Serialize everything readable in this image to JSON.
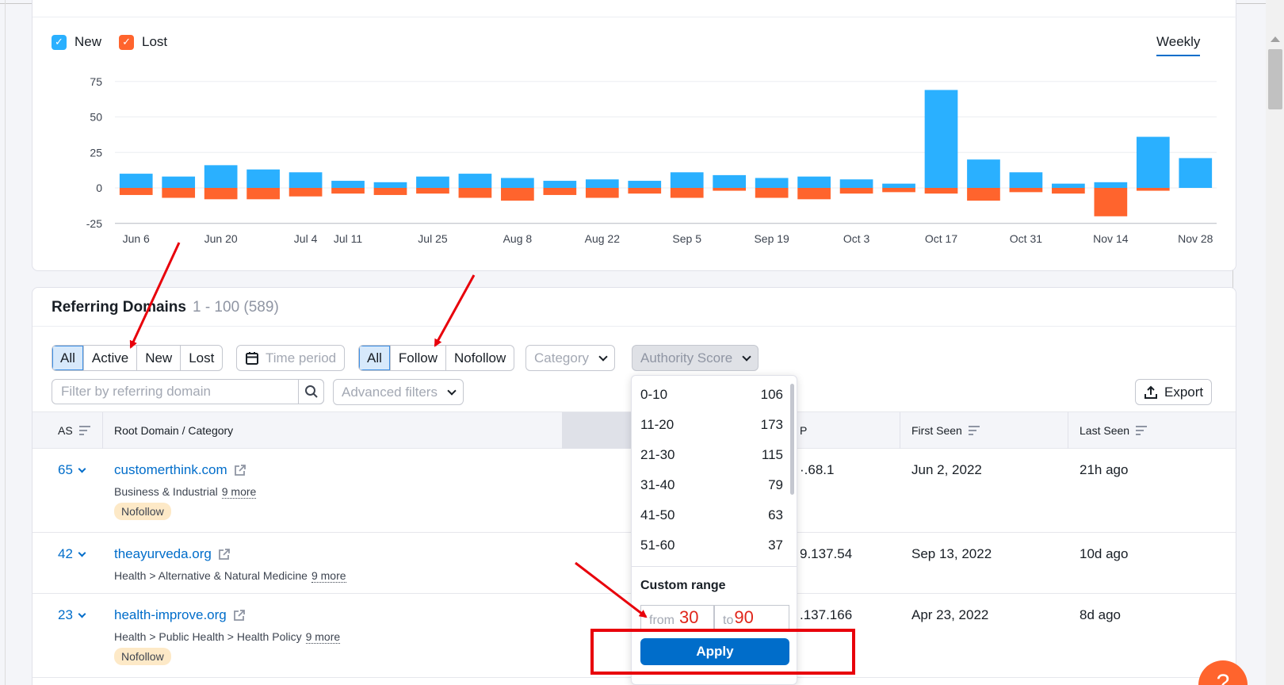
{
  "legend": {
    "new_label": "New",
    "lost_label": "Lost",
    "new_color": "#2ab0ff",
    "lost_color": "#ff642d"
  },
  "period_toggle": "Weekly",
  "chart_data": {
    "type": "bar",
    "title": "",
    "xlabel": "",
    "ylabel": "",
    "yticks": [
      75,
      50,
      25,
      0,
      -25
    ],
    "ylim": [
      -25,
      75
    ],
    "grid": true,
    "legend_position": "top-left",
    "x_tick_labels": [
      "Jun 6",
      "Jun 20",
      "Jul 4",
      "Jul 11",
      "Jul 25",
      "Aug 8",
      "Aug 22",
      "Sep 5",
      "Sep 19",
      "Oct 3",
      "Oct 17",
      "Oct 31",
      "Nov 14",
      "Nov 28"
    ],
    "series": [
      {
        "name": "New",
        "color": "#2ab0ff",
        "values": [
          10,
          8,
          16,
          13,
          11,
          5,
          4,
          8,
          10,
          7,
          5,
          6,
          5,
          11,
          9,
          7,
          8,
          6,
          3,
          69,
          20,
          11,
          3,
          4,
          36,
          21
        ]
      },
      {
        "name": "Lost",
        "color": "#ff642d",
        "values": [
          -5,
          -7,
          -8,
          -8,
          -6,
          -4,
          -5,
          -4,
          -7,
          -9,
          -5,
          -7,
          -4,
          -7,
          -2,
          -7,
          -8,
          -4,
          -3,
          -4,
          -9,
          -3,
          -4,
          -20,
          -2,
          0
        ]
      }
    ]
  },
  "referring_domains": {
    "title": "Referring Domains",
    "count": "1 - 100 (589)",
    "type_filter": [
      "All",
      "Active",
      "New",
      "Lost"
    ],
    "time_period": "Time period",
    "link_filter": [
      "All",
      "Follow",
      "Nofollow"
    ],
    "category": "Category",
    "authority_score": "Authority Score",
    "search_placeholder": "Filter by referring domain",
    "advanced_filters": "Advanced filters",
    "export": "Export",
    "columns": {
      "as": "AS",
      "root_domain": "Root Domain / Category",
      "ip": "P",
      "first_seen": "First Seen",
      "last_seen": "Last Seen"
    },
    "rows": [
      {
        "as": "65",
        "domain": "customerthink.com",
        "category": "Business & Industrial",
        "more": "9 more",
        "badge": "Nofollow",
        "ip": "·.68.1",
        "first_seen": "Jun 2, 2022",
        "last_seen": "21h ago"
      },
      {
        "as": "42",
        "domain": "theayurveda.org",
        "category": "Health > Alternative & Natural Medicine",
        "more": "9 more",
        "badge": "",
        "ip": "9.137.54",
        "first_seen": "Sep 13, 2022",
        "last_seen": "10d ago"
      },
      {
        "as": "23",
        "domain": "health-improve.org",
        "category": "Health > Public Health > Health Policy",
        "more": "9 more",
        "badge": "Nofollow",
        "ip": ".137.166",
        "first_seen": "Apr 23, 2022",
        "last_seen": "8d ago"
      }
    ]
  },
  "authority_dropdown": {
    "ranges": [
      {
        "label": "0-10",
        "count": "106"
      },
      {
        "label": "11-20",
        "count": "173"
      },
      {
        "label": "21-30",
        "count": "115"
      },
      {
        "label": "31-40",
        "count": "79"
      },
      {
        "label": "41-50",
        "count": "63"
      },
      {
        "label": "51-60",
        "count": "37"
      }
    ],
    "custom_range": "Custom range",
    "from_placeholder": "from",
    "from_value": "30",
    "to_placeholder": "to",
    "to_value": "90",
    "apply": "Apply"
  },
  "help_label": "?"
}
